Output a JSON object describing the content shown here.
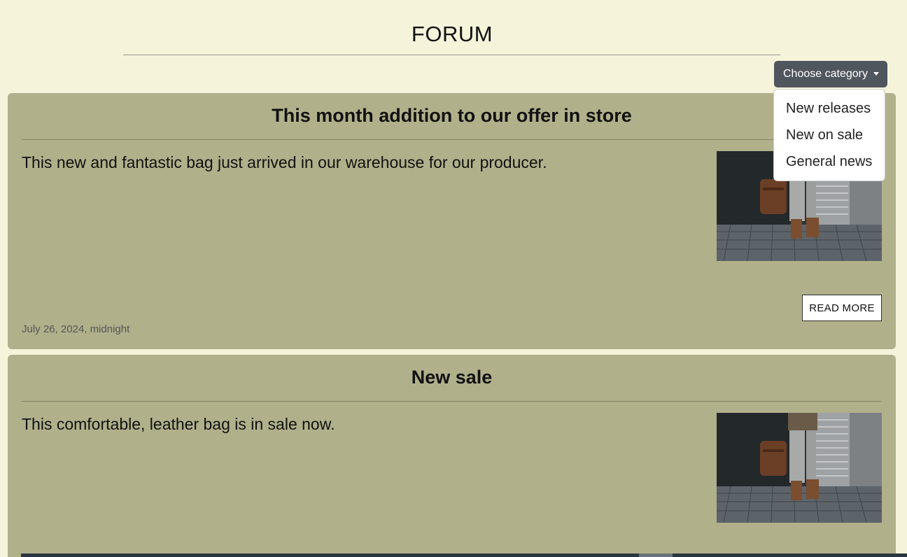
{
  "header": {
    "title": "FORUM"
  },
  "category_dropdown": {
    "label": "Choose category",
    "open": true,
    "options": [
      "New releases",
      "New on sale",
      "General news"
    ]
  },
  "posts": [
    {
      "title": "This month addition to our offer in store",
      "text": "This new and fantastic bag just arrived in our warehouse for our producer.",
      "image": "photo-person-with-leather-bag",
      "read_more_label": "READ MORE",
      "date": "July 26, 2024, midnight"
    },
    {
      "title": "New sale",
      "text": "This comfortable, leather bag is in sale now.",
      "image": "photo-person-with-leather-bag"
    }
  ],
  "colors": {
    "background": "#f5f4db",
    "card": "#b0b08b",
    "dropdown_button": "#50565e"
  }
}
